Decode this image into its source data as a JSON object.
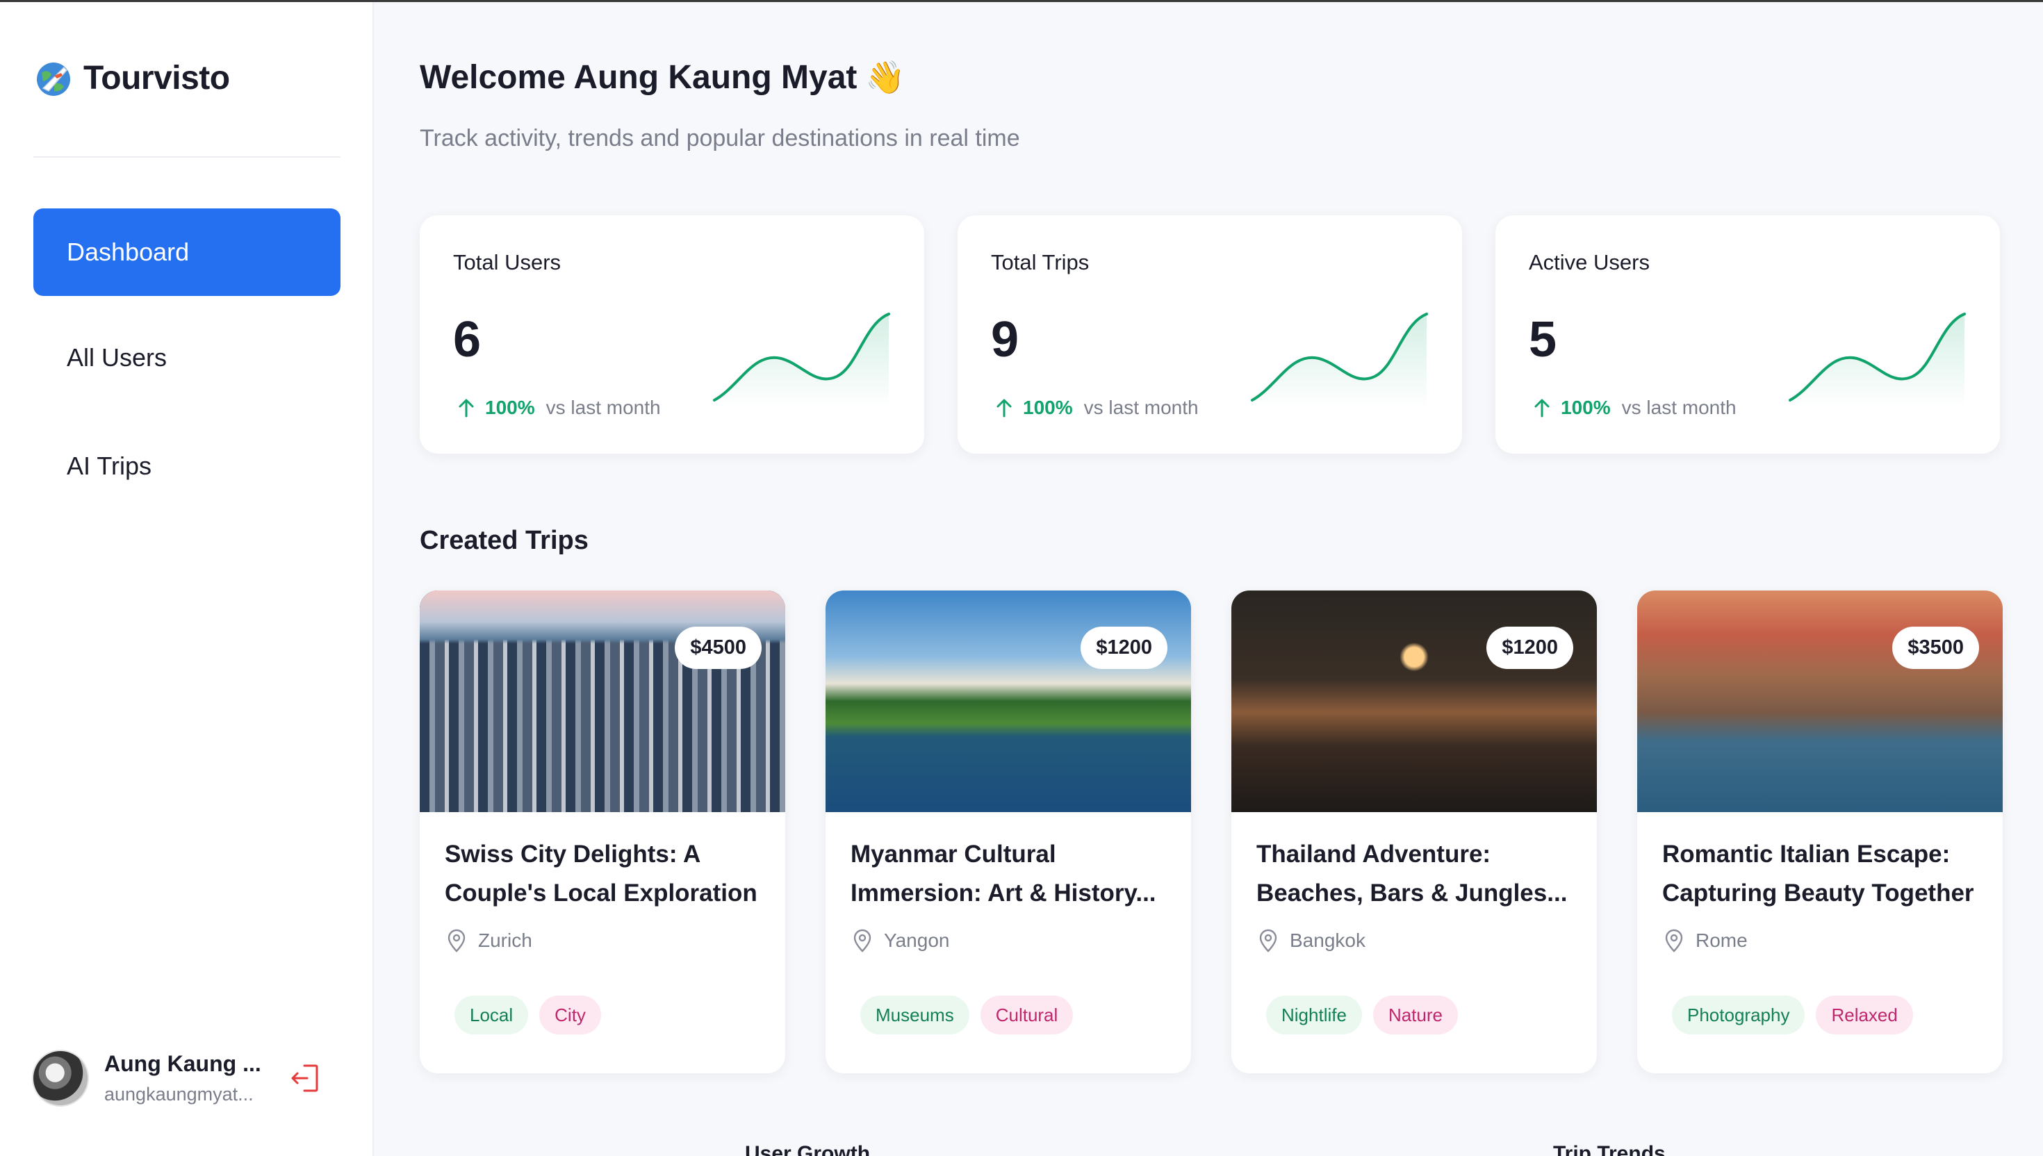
{
  "brand": {
    "name": "Tourvisto",
    "icon": "globe-plane-icon"
  },
  "sidebar": {
    "items": [
      {
        "label": "Dashboard",
        "active": true
      },
      {
        "label": "All Users",
        "active": false
      },
      {
        "label": "AI Trips",
        "active": false
      }
    ],
    "user": {
      "name": "Aung Kaung ...",
      "email": "aungkaungmyat..."
    }
  },
  "header": {
    "welcome": "Welcome Aung Kaung Myat",
    "wave": "👋",
    "subtitle": "Track activity, trends and popular destinations in real time"
  },
  "stats": [
    {
      "label": "Total Users",
      "value": "6",
      "change": "100%",
      "compare": "vs last month"
    },
    {
      "label": "Total Trips",
      "value": "9",
      "change": "100%",
      "compare": "vs last month"
    },
    {
      "label": "Active Users",
      "value": "5",
      "change": "100%",
      "compare": "vs last month"
    }
  ],
  "trips_section": {
    "title": "Created Trips"
  },
  "trips": [
    {
      "price": "$4500",
      "title": "Swiss City Delights: A Couple's Local Exploration",
      "location": "Zurich",
      "tags": [
        "Local",
        "City"
      ]
    },
    {
      "price": "$1200",
      "title": "Myanmar Cultural Immersion: Art & History...",
      "location": "Yangon",
      "tags": [
        "Museums",
        "Cultural"
      ]
    },
    {
      "price": "$1200",
      "title": "Thailand Adventure: Beaches, Bars & Jungles...",
      "location": "Bangkok",
      "tags": [
        "Nightlife",
        "Nature"
      ]
    },
    {
      "price": "$3500",
      "title": "Romantic Italian Escape: Capturing Beauty Together",
      "location": "Rome",
      "tags": [
        "Photography",
        "Relaxed"
      ]
    }
  ],
  "bottom": {
    "user_growth": "User Growth",
    "trip_trends": "Trip Trends"
  },
  "colors": {
    "accent": "#256ff1",
    "positive": "#10a36b",
    "tag_green_text": "#138054",
    "tag_pink_text": "#c0266b"
  }
}
